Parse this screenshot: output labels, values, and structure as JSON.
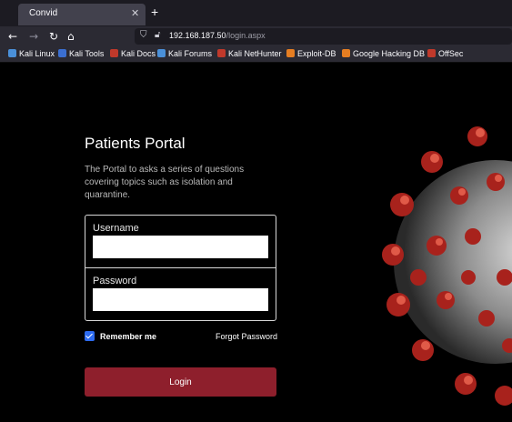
{
  "browser": {
    "tab_title": "Convid",
    "tab_close": "✕",
    "new_tab": "+",
    "url_host": "192.168.187.50",
    "url_path": "/login.aspx",
    "bookmarks": [
      {
        "label": "Kali Linux",
        "color": "#4a90d9"
      },
      {
        "label": "Kali Tools",
        "color": "#3b6fd1"
      },
      {
        "label": "Kali Docs",
        "color": "#c0392b"
      },
      {
        "label": "Kali Forums",
        "color": "#4a90d9"
      },
      {
        "label": "Kali NetHunter",
        "color": "#c0392b"
      },
      {
        "label": "Exploit-DB",
        "color": "#e67e22"
      },
      {
        "label": "Google Hacking DB",
        "color": "#e67e22"
      },
      {
        "label": "OffSec",
        "color": "#c0392b"
      }
    ]
  },
  "page": {
    "title": "Patients Portal",
    "description": "The Portal to asks a series of questions covering topics such as isolation and quarantine.",
    "username_label": "Username",
    "username_value": "",
    "password_label": "Password",
    "password_value": "",
    "remember_label": "Remember me",
    "remember_checked": true,
    "forgot_label": "Forgot Password",
    "login_label": "Login"
  },
  "colors": {
    "login_button": "#8e1f2c",
    "checkbox": "#2d6bf0",
    "background": "#000000"
  }
}
